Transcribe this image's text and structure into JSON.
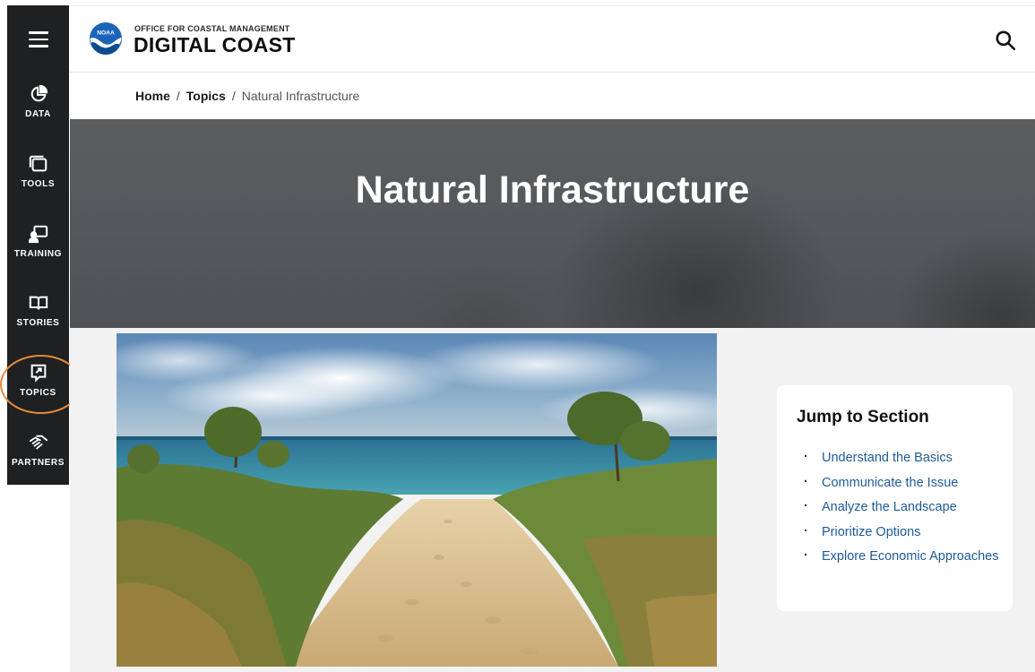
{
  "sidebar": {
    "items": [
      {
        "label": "DATA",
        "icon": "pie-chart-icon"
      },
      {
        "label": "TOOLS",
        "icon": "tools-windows-icon"
      },
      {
        "label": "TRAINING",
        "icon": "training-presenter-icon"
      },
      {
        "label": "STORIES",
        "icon": "open-book-icon"
      },
      {
        "label": "TOPICS",
        "icon": "topics-arrow-box-icon"
      },
      {
        "label": "PARTNERS",
        "icon": "handshake-icon"
      }
    ],
    "highlight_color": "#e68a3c"
  },
  "header": {
    "logo_text": "NOAA",
    "brand_small": "OFFICE FOR COASTAL MANAGEMENT",
    "brand_big": "DIGITAL COAST"
  },
  "breadcrumb": {
    "home": "Home",
    "topics": "Topics",
    "separator": "/",
    "current": "Natural Infrastructure"
  },
  "hero": {
    "title": "Natural Infrastructure"
  },
  "jump": {
    "title": "Jump to Section",
    "items": [
      "Understand the Basics",
      "Communicate the Issue",
      "Analyze the Landscape",
      "Prioritize Options",
      "Explore Economic Approaches"
    ]
  },
  "colors": {
    "sidebar_bg": "#1f2022",
    "link": "#1e5b99",
    "hero_bg": "#58595b",
    "content_bg": "#f2f2f2"
  }
}
